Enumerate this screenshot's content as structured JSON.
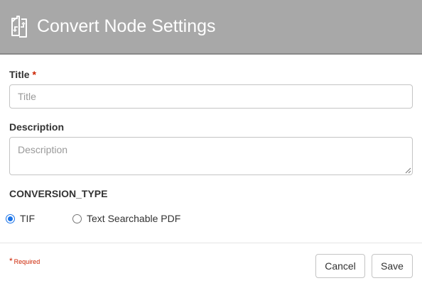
{
  "dialog": {
    "title": "Convert Node Settings",
    "header_icon": "convert-document-icon"
  },
  "form": {
    "title_field": {
      "label": "Title",
      "required_marker": "*",
      "placeholder": "Title",
      "value": ""
    },
    "description_field": {
      "label": "Description",
      "placeholder": "Description",
      "value": ""
    },
    "conversion_type": {
      "label": "CONVERSION_TYPE",
      "options": [
        {
          "label": "TIF",
          "selected": true
        },
        {
          "label": "Text Searchable PDF",
          "selected": false
        }
      ]
    }
  },
  "footer": {
    "required_star": "*",
    "required_note": "Required",
    "cancel_label": "Cancel",
    "save_label": "Save"
  },
  "colors": {
    "header_bg": "#a8a8a8",
    "required": "#cc2200",
    "radio_selected": "#1a73e8"
  }
}
